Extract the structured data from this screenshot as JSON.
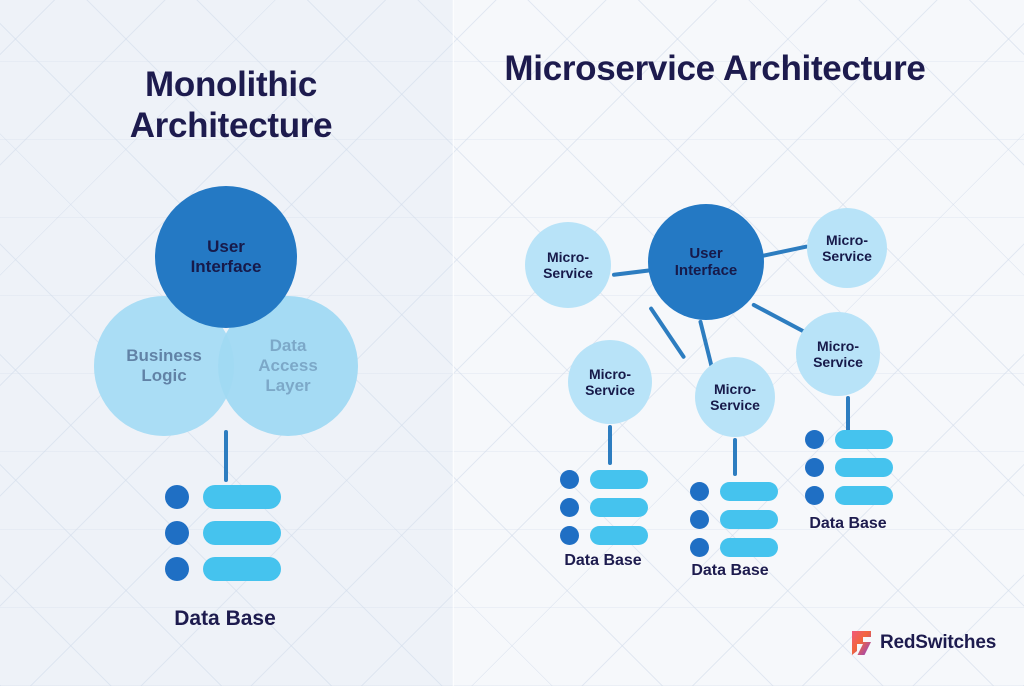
{
  "meta": {
    "background_color": "#eff3f8",
    "accent_dark_blue": "#2479c4",
    "accent_light_blue": "#b8e3f8",
    "accent_cyan": "#45c3ee",
    "text_navy": "#1d1b4e",
    "line_blue": "#2d7dc0"
  },
  "left_panel": {
    "title_line1": "Monolithic",
    "title_line2": "Architecture",
    "circles": [
      {
        "id": "user-interface",
        "line1": "User",
        "line2": "Interface",
        "style": "dark"
      },
      {
        "id": "business-logic",
        "line1": "Business",
        "line2": "Logic",
        "style": "light"
      },
      {
        "id": "data-access-layer",
        "line1": "Data",
        "line2": "Access",
        "line3": "Layer",
        "style": "light"
      }
    ],
    "database": {
      "label": "Data Base",
      "dots": 3,
      "bars": 3
    }
  },
  "right_panel": {
    "title_line1": "Microservice",
    "title_line2": "Architecture",
    "center_circle": {
      "line1": "User",
      "line2": "Interface",
      "style": "dark"
    },
    "microservices": [
      {
        "id": "ms-left",
        "line1": "Micro-",
        "line2": "Service"
      },
      {
        "id": "ms-top-right",
        "line1": "Micro-",
        "line2": "Service"
      },
      {
        "id": "ms-bottom-left",
        "line1": "Micro-",
        "line2": "Service"
      },
      {
        "id": "ms-bottom-mid",
        "line1": "Micro-",
        "line2": "Service"
      },
      {
        "id": "ms-right-lower",
        "line1": "Micro-",
        "line2": "Service"
      }
    ],
    "databases": [
      {
        "id": "db-left",
        "label": "Data Base",
        "dots": 3,
        "bars": 3
      },
      {
        "id": "db-mid",
        "label": "Data Base",
        "dots": 3,
        "bars": 3
      },
      {
        "id": "db-right",
        "label": "Data Base",
        "dots": 3,
        "bars": 3
      }
    ]
  },
  "branding": {
    "name": "RedSwitches",
    "mark": "redswitches-logo-mark"
  }
}
